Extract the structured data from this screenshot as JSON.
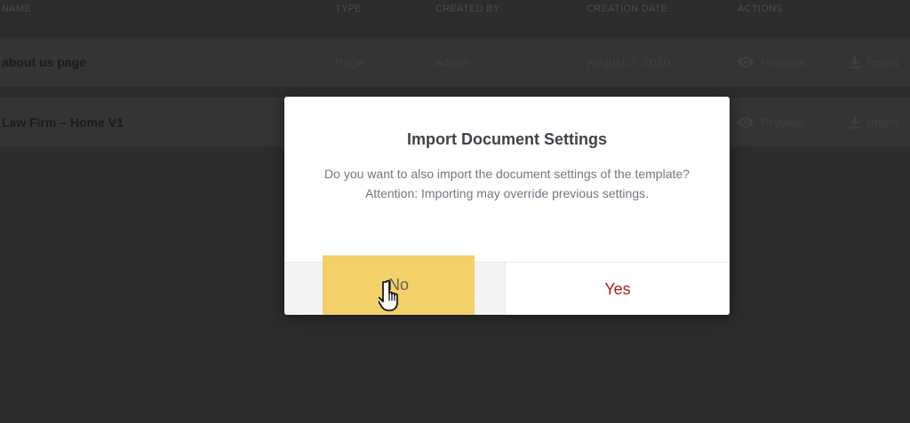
{
  "table": {
    "headers": [
      "NAME",
      "TYPE",
      "CREATED BY",
      "CREATION DATE",
      "ACTIONS"
    ],
    "rows": [
      {
        "name": "about us page",
        "type": "Page",
        "created_by": "admin",
        "date": "August 2, 2020",
        "preview": "Preview",
        "insert": "Insert"
      },
      {
        "name": "Law Firm – Home V1",
        "type": "",
        "created_by": "",
        "date": "",
        "preview": "Preview",
        "insert": "Insert"
      }
    ]
  },
  "modal": {
    "title": "Import Document Settings",
    "message_line1": "Do you want to also import the document settings of the template?",
    "message_line2": "Attention: Importing may override previous settings.",
    "no_label": "No",
    "yes_label": "Yes"
  },
  "icons": {
    "preview": "eye-icon",
    "insert": "download-icon",
    "cursor": "hand-pointer-icon"
  },
  "colors": {
    "yes": "#b01b1b",
    "highlight": "#f2cc5f",
    "overlay": "#2c2c2c"
  }
}
